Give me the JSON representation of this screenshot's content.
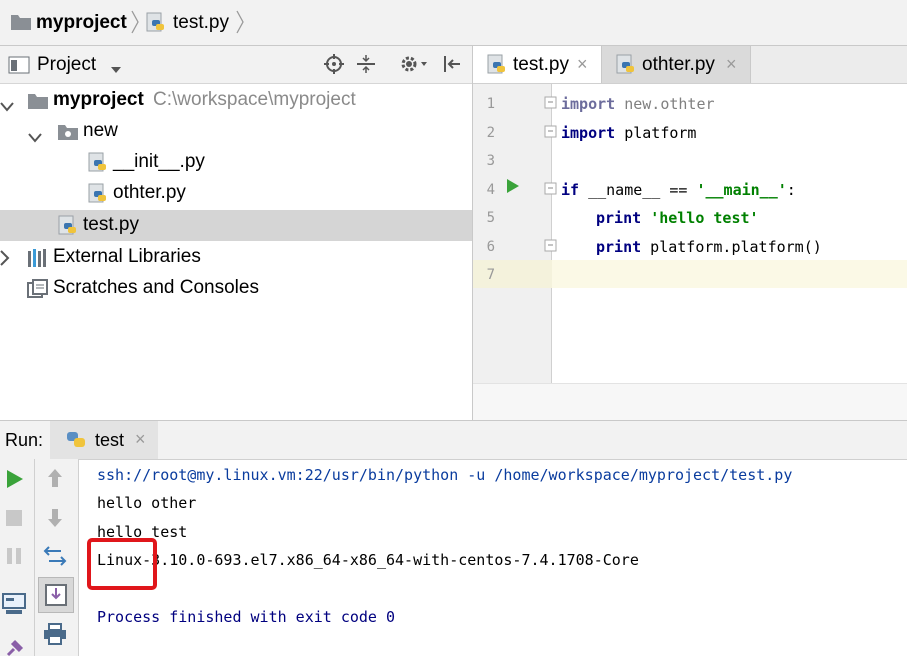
{
  "breadcrumb": {
    "project": "myproject",
    "file": "test.py"
  },
  "project_panel": {
    "title": "Project",
    "tree": [
      {
        "label": "myproject",
        "path": "C:\\workspace\\myproject"
      },
      {
        "label": "new"
      },
      {
        "label": "__init__.py"
      },
      {
        "label": "othter.py"
      },
      {
        "label": "test.py"
      },
      {
        "label": "External Libraries"
      },
      {
        "label": "Scratches and Consoles"
      }
    ]
  },
  "editor": {
    "tabs": [
      {
        "label": "test.py"
      },
      {
        "label": "othter.py"
      }
    ],
    "line_numbers": [
      "1",
      "2",
      "3",
      "4",
      "5",
      "6",
      "7"
    ],
    "lines": {
      "l1_kw": "import",
      "l1_rest": " new.othter",
      "l2_kw": "import",
      "l2_rest": " platform",
      "l4_kw": "if",
      "l4_rest": " __name__ == ",
      "l4_str": "'__main__'",
      "l4_end": ":",
      "l5_kw": "print",
      "l5_str": "'hello test'",
      "l6_kw": "print",
      "l6_rest": " platform.platform()"
    }
  },
  "run_panel": {
    "label": "Run:",
    "tab": "test",
    "output": [
      "ssh://root@my.linux.vm:22/usr/bin/python -u /home/workspace/myproject/test.py",
      "hello other",
      "hello test",
      "Linux-3.10.0-693.el7.x86_64-x86_64-with-centos-7.4.1708-Core",
      "",
      "Process finished with exit code 0"
    ]
  },
  "colors": {
    "keyword": "#000080",
    "string": "#008000",
    "link": "#0a3c9e",
    "process": "#00007f",
    "highlight_box": "#e0161b",
    "run_green": "#3aa33a"
  }
}
